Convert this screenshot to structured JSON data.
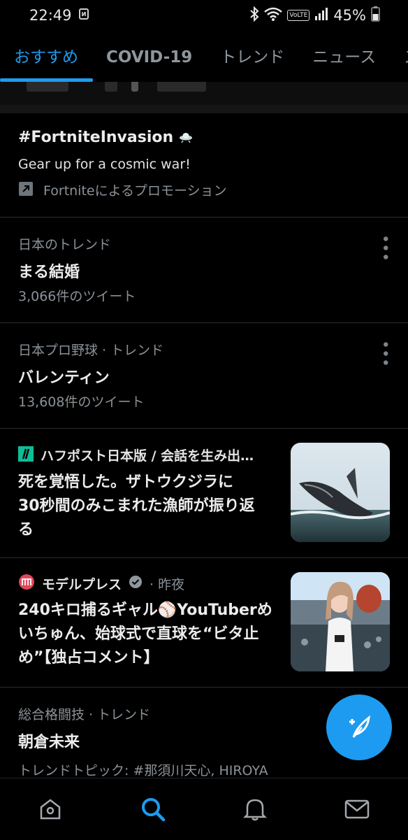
{
  "status_bar": {
    "time": "22:49",
    "battery": "45%",
    "volte": "VoLTE"
  },
  "tabs": [
    {
      "label": "おすすめ",
      "active": true
    },
    {
      "label": "COVID-19",
      "active": false
    },
    {
      "label": "トレンド",
      "active": false
    },
    {
      "label": "ニュース",
      "active": false
    },
    {
      "label": "ス",
      "active": false
    }
  ],
  "promo": {
    "hashtag": "#FortniteInvasion",
    "body": "Gear up for a cosmic war!",
    "promoted_by": "Fortniteによるプロモーション"
  },
  "trends": [
    {
      "context": "日本のトレンド",
      "title": "まる結婚",
      "count": "3,066件のツイート"
    },
    {
      "context": "日本プロ野球 · トレンド",
      "title": "バレンティン",
      "count": "13,608件のツイート"
    }
  ],
  "news": [
    {
      "source": "ハフポスト日本版 / 会話を生み出…",
      "title_lines": [
        "死を覚悟した。ザトウクジラに",
        "30秒間のみこまれた漁師が振り返",
        "る"
      ]
    },
    {
      "source": "モデルプレス",
      "time": "· 昨夜",
      "title_lines": [
        "240キロ捕るギャル⚾YouTuberめ",
        "いちゅん、始球式で直球を“ビタ止",
        "め”【独占コメント】"
      ]
    }
  ],
  "bottom_trend": {
    "context": "総合格闘技 · トレンド",
    "title": "朝倉未来",
    "topics": "トレンドトピック: #那須川天心, HIROYA"
  },
  "colors": {
    "accent": "#1d9bf0",
    "background": "#000000"
  }
}
